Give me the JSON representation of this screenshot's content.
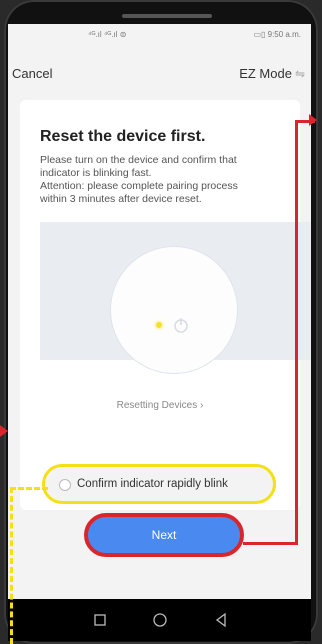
{
  "status": {
    "signal": "⁴ᴳ.ıl ⁴ᴳ.ıl ⊜",
    "battery_time": "▭▯ 9:50 a.m."
  },
  "header": {
    "cancel_label": "Cancel",
    "mode_label": "EZ Mode",
    "mode_icon": "swap-arrows-icon"
  },
  "card": {
    "title": "Reset the device first.",
    "description_lines": [
      "Please turn on the device and confirm that",
      "indicator is blinking fast.",
      "Attention: please complete pairing process",
      "within 3 minutes after device reset."
    ],
    "resetting_link": "Resetting Devices ›"
  },
  "confirm": {
    "label": "Confirm indicator rapidly blink",
    "checked": false
  },
  "next_button": {
    "label": "Next"
  },
  "colors": {
    "accent_blue": "#4a8af0",
    "highlight_red": "#d9262c",
    "highlight_yellow": "#f3e017",
    "indicator": "#f4e22a"
  },
  "navbar": {
    "icons": [
      "square-recent-icon",
      "circle-home-icon",
      "triangle-back-icon"
    ]
  }
}
